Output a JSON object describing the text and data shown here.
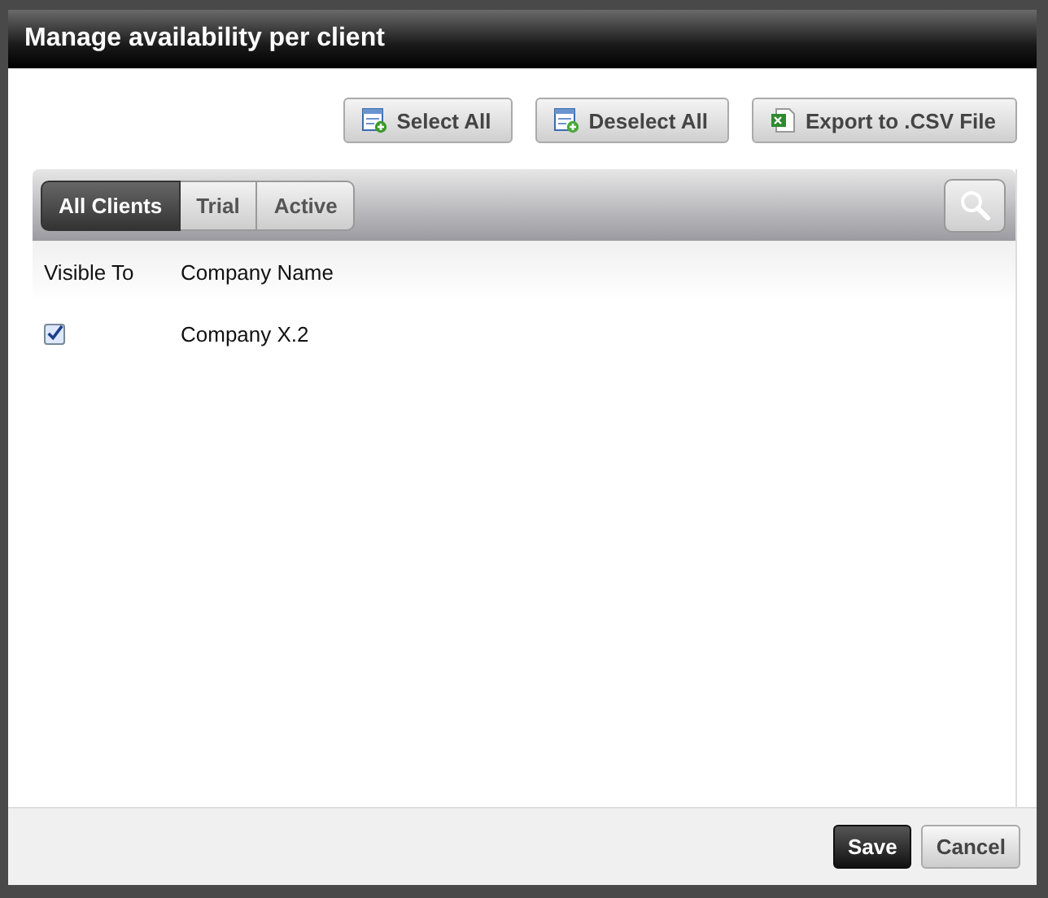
{
  "dialog": {
    "title": "Manage availability per client"
  },
  "toolbar_buttons": [
    {
      "label": "Select All",
      "kind": "select"
    },
    {
      "label": "Deselect All",
      "kind": "deselect"
    },
    {
      "label": "Export to .CSV File",
      "kind": "export"
    }
  ],
  "filter_tabs": [
    {
      "label": "All Clients",
      "selected": true
    },
    {
      "label": "Trial",
      "selected": false
    },
    {
      "label": "Active",
      "selected": false
    }
  ],
  "table": {
    "columns": [
      "Visible To",
      "Company Name"
    ],
    "rows": [
      {
        "visible": true,
        "company": "Company X.2"
      }
    ]
  },
  "footer_buttons": [
    {
      "label": "Save",
      "kind": "primary"
    },
    {
      "label": "Cancel",
      "kind": "secondary"
    }
  ]
}
